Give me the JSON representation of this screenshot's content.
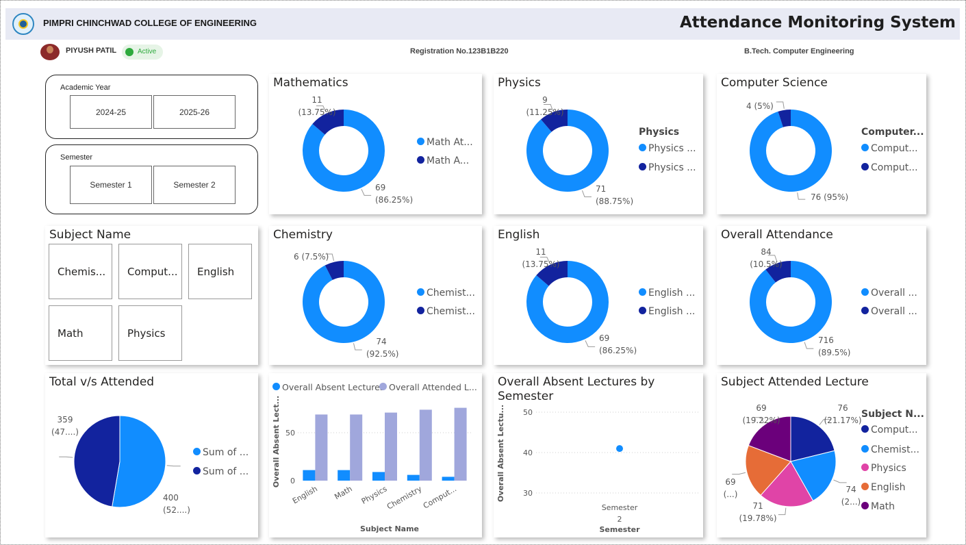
{
  "header": {
    "college": "PIMPRI CHINCHWAD COLLEGE OF ENGINEERING",
    "title": "Attendance Monitoring System",
    "logo_icon": "college-logo-icon"
  },
  "student": {
    "name": "PIYUSH PATIL",
    "status": "Active",
    "registration": "Registration No.123B1B220",
    "program": "B.Tech. Computer Engineering"
  },
  "colors": {
    "attended": "#118dff",
    "absent": "#12239e",
    "secondary": "#a0a7dc",
    "pink": "#e044a7",
    "orange": "#e66c37",
    "purple": "#6b007b",
    "header_bg": "#e8eaf4",
    "active": "#2eaa3d"
  },
  "filters": {
    "academic_year": {
      "label": "Academic Year",
      "options": [
        "2024-25",
        "2025-26"
      ]
    },
    "semester": {
      "label": "Semester",
      "options": [
        "Semester 1",
        "Semester 2"
      ]
    },
    "subject": {
      "label": "Subject Name",
      "options": [
        "Chemis...",
        "Comput...",
        "English",
        "Math",
        "Physics"
      ]
    }
  },
  "chart_data": [
    {
      "type": "donut",
      "title": "Mathematics",
      "slices": [
        {
          "name": "Math At...",
          "value": 69,
          "label_value": "69",
          "label_pct": "(86.25%)"
        },
        {
          "name": "Math A...",
          "value": 11,
          "label_value": "11",
          "label_pct": "(13.75%)"
        }
      ]
    },
    {
      "type": "donut",
      "title": "Physics",
      "legend_title": "Physics",
      "slices": [
        {
          "name": "Physics ...",
          "value": 71,
          "label_value": "71",
          "label_pct": "(88.75%)"
        },
        {
          "name": "Physics ...",
          "value": 9,
          "label_value": "9",
          "label_pct": "(11.25%)"
        }
      ]
    },
    {
      "type": "donut",
      "title": "Computer Science",
      "legend_title": "Computer...",
      "slices": [
        {
          "name": "Comput...",
          "value": 76,
          "label_value": "76 (95%)",
          "label_pct": ""
        },
        {
          "name": "Comput...",
          "value": 4,
          "label_value": "4 (5%)",
          "label_pct": ""
        }
      ]
    },
    {
      "type": "donut",
      "title": "Chemistry",
      "slices": [
        {
          "name": "Chemist...",
          "value": 74,
          "label_value": "74",
          "label_pct": "(92.5%)"
        },
        {
          "name": "Chemist...",
          "value": 6,
          "label_value": "6 (7.5%)",
          "label_pct": ""
        }
      ]
    },
    {
      "type": "donut",
      "title": "English",
      "slices": [
        {
          "name": "English ...",
          "value": 69,
          "label_value": "69",
          "label_pct": "(86.25%)"
        },
        {
          "name": "English ...",
          "value": 11,
          "label_value": "11",
          "label_pct": "(13.75%)"
        }
      ]
    },
    {
      "type": "donut",
      "title": "Overall Attendance",
      "slices": [
        {
          "name": "Overall ...",
          "value": 716,
          "label_value": "716",
          "label_pct": "(89.5%)"
        },
        {
          "name": "Overall ...",
          "value": 84,
          "label_value": "84",
          "label_pct": "(10.5%)"
        }
      ]
    },
    {
      "type": "pie",
      "title": "Total v/s Attended",
      "slices": [
        {
          "name": "Sum of ...",
          "value": 400,
          "label_value": "400",
          "label_pct": "(52....)"
        },
        {
          "name": "Sum of ...",
          "value": 359,
          "label_value": "359",
          "label_pct": "(47....)"
        }
      ]
    },
    {
      "type": "bar",
      "title": "",
      "categories": [
        "English",
        "Math",
        "Physics",
        "Chemistry",
        "Comput..."
      ],
      "series": [
        {
          "name": "Overall Absent Lectures",
          "values": [
            11,
            11,
            9,
            6,
            4
          ]
        },
        {
          "name": "Overall Attended L...",
          "values": [
            69,
            69,
            71,
            74,
            76
          ]
        }
      ],
      "xlabel": "Subject Name",
      "ylabel": "Overall Absent Lect...",
      "yticks": [
        0,
        50
      ],
      "ylim": [
        0,
        80
      ]
    },
    {
      "type": "scatter",
      "title": "Overall Absent Lectures by Semester",
      "categories": [
        "Semester 2"
      ],
      "x_tick_line1": "Semester",
      "x_tick_line2": "2",
      "values": [
        41
      ],
      "xlabel": "Semester",
      "ylabel": "Overall Absent Lectu...",
      "yticks": [
        30,
        40,
        50
      ],
      "ylim": [
        27,
        53
      ]
    },
    {
      "type": "pie",
      "title": "Subject Attended Lecture",
      "legend_title": "Subject N...",
      "slices": [
        {
          "name": "Comput...",
          "value": 76,
          "label_value": "76",
          "label_pct": "(21.17%)"
        },
        {
          "name": "Chemist...",
          "value": 74,
          "label_value": "74",
          "label_pct": "(2...)"
        },
        {
          "name": "Physics",
          "value": 71,
          "label_value": "71",
          "label_pct": "(19.78%)"
        },
        {
          "name": "English",
          "value": 69,
          "label_value": "69",
          "label_pct": "(...)"
        },
        {
          "name": "Math",
          "value": 69,
          "label_value": "69",
          "label_pct": "(19.22%)"
        }
      ]
    }
  ]
}
